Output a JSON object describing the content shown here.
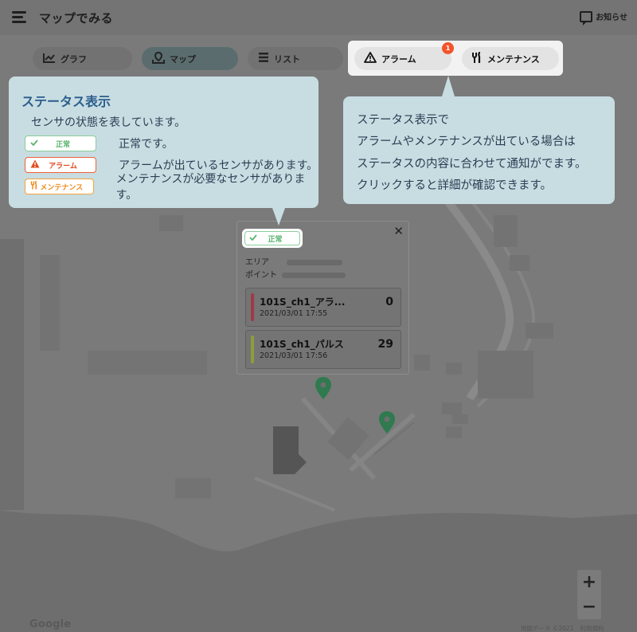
{
  "app": {
    "title": "マップでみる",
    "notice_label": "お知らせ"
  },
  "tabs": [
    {
      "label": "グラフ",
      "icon": "line-chart-icon"
    },
    {
      "label": "マップ",
      "icon": "map-pin-icon",
      "active": true
    },
    {
      "label": "リスト",
      "icon": "list-icon"
    }
  ],
  "controls": {
    "alarm_label": "アラーム",
    "alarm_count": "1",
    "maintenance_label": "メンテナンス"
  },
  "callout_left": {
    "title": "ステータス表示",
    "subtitle": "センサの状態を表しています。",
    "legend": [
      {
        "label": "正常",
        "desc": "正常です。",
        "color": "#59b56d"
      },
      {
        "label": "アラーム",
        "desc": "アラームが出ているセンサがあります。",
        "color": "#e04a1e"
      },
      {
        "label": "メンテナンス",
        "desc": "メンテナンスが必要なセンサがあります。",
        "color": "#ef8a1c"
      }
    ]
  },
  "callout_right": {
    "lines": [
      "ステータス表示で",
      "アラームやメンテナンスが出ている場合は",
      "ステータスの内容に合わせて通知がでます。",
      "クリックすると詳細が確認できます。"
    ]
  },
  "popup": {
    "status_label": "正常",
    "area_label": "エリア",
    "point_label": "ポイント",
    "sensors": [
      {
        "name": "101S_ch1_アラ...",
        "time": "2021/03/01 17:55",
        "value": "0",
        "color": "#a23846"
      },
      {
        "name": "101S_ch1_パルス",
        "time": "2021/03/01 17:56",
        "value": "29",
        "color": "#8e9d3a"
      }
    ]
  },
  "map": {
    "zoom_in": "+",
    "zoom_out": "−",
    "google_logo": "Google",
    "map_data": "地図データ ©2021",
    "terms": "利用規約",
    "marker_color": "#2f7a4f"
  }
}
